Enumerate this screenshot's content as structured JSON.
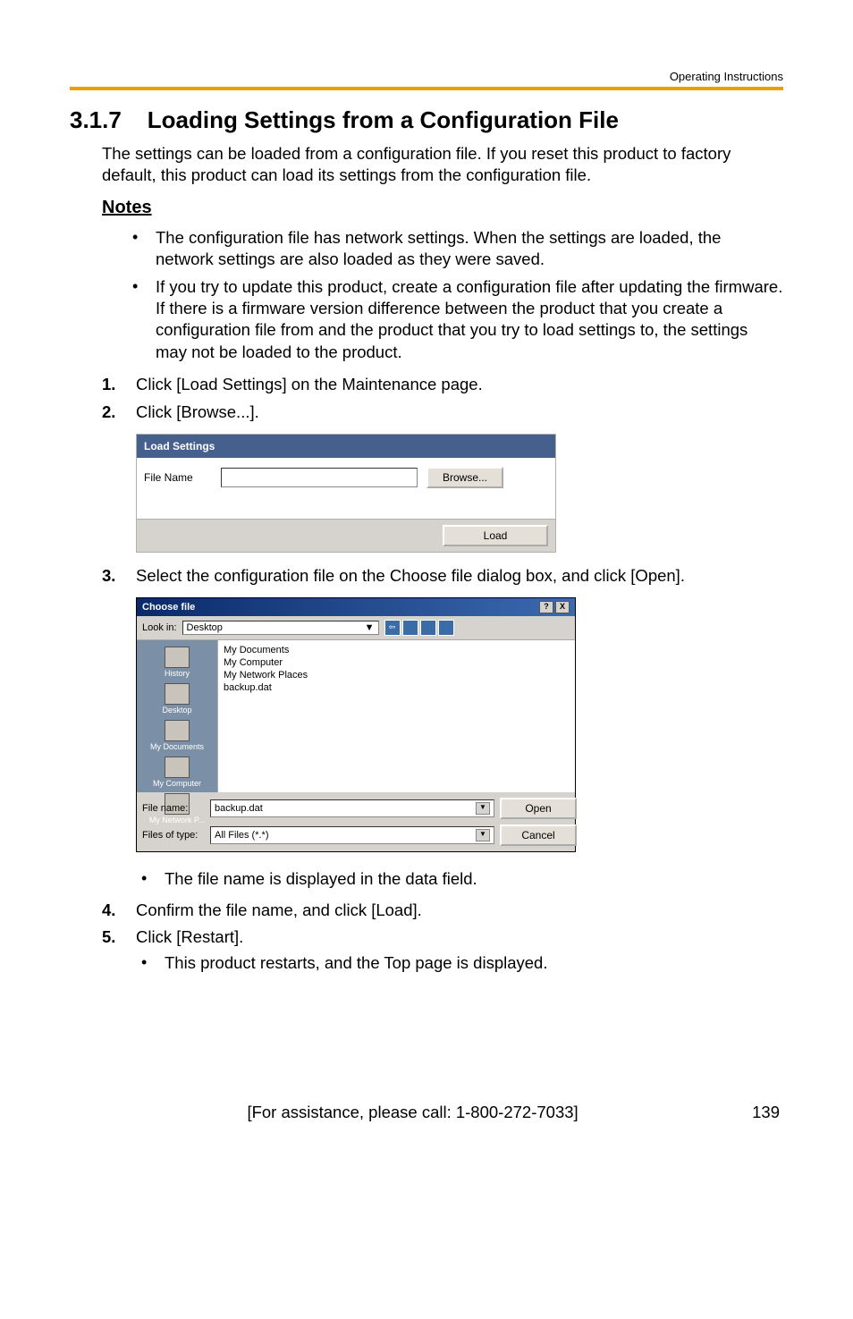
{
  "header": {
    "right_text": "Operating Instructions"
  },
  "section": {
    "number": "3.1.7",
    "title": "Loading Settings from a Configuration File",
    "intro": "The settings can be loaded from a configuration file. If you reset this product to factory default, this product can load its settings from the configuration file."
  },
  "notes": {
    "heading": "Notes",
    "items": [
      "The configuration file has network settings. When the settings are loaded, the network settings are also loaded as they were saved.",
      "If you try to update this product, create a configuration file after updating the firmware. If there is a firmware version difference between the product that you create a configuration file from and the product that you try to load settings to, the settings may not be loaded to the product."
    ]
  },
  "steps": {
    "s1": {
      "num": "1.",
      "text": "Click [Load Settings] on the Maintenance page."
    },
    "s2": {
      "num": "2.",
      "text": "Click [Browse...]."
    },
    "s3": {
      "num": "3.",
      "text": "Select the configuration file on the Choose file dialog box, and click [Open]."
    },
    "s3_sub": "The file name is displayed in the data field.",
    "s4": {
      "num": "4.",
      "text": "Confirm the file name, and click [Load]."
    },
    "s5": {
      "num": "5.",
      "text": "Click [Restart]."
    },
    "s5_sub": "This product restarts, and the Top page is displayed."
  },
  "load_settings_panel": {
    "title": "Load Settings",
    "file_label": "File Name",
    "browse_btn": "Browse...",
    "load_btn": "Load"
  },
  "choose_file_dialog": {
    "title": "Choose file",
    "help_btn": "?",
    "close_btn": "X",
    "lookin_label": "Look in:",
    "lookin_value": "Desktop",
    "sidebar": [
      "History",
      "Desktop",
      "My Documents",
      "My Computer",
      "My Network P..."
    ],
    "files": [
      "My Documents",
      "My Computer",
      "My Network Places",
      "backup.dat"
    ],
    "filename_label": "File name:",
    "filename_value": "backup.dat",
    "filetype_label": "Files of type:",
    "filetype_value": "All Files (*.*)",
    "open_btn": "Open",
    "cancel_btn": "Cancel"
  },
  "footer": {
    "assist": "[For assistance, please call: 1-800-272-7033]",
    "page": "139"
  }
}
